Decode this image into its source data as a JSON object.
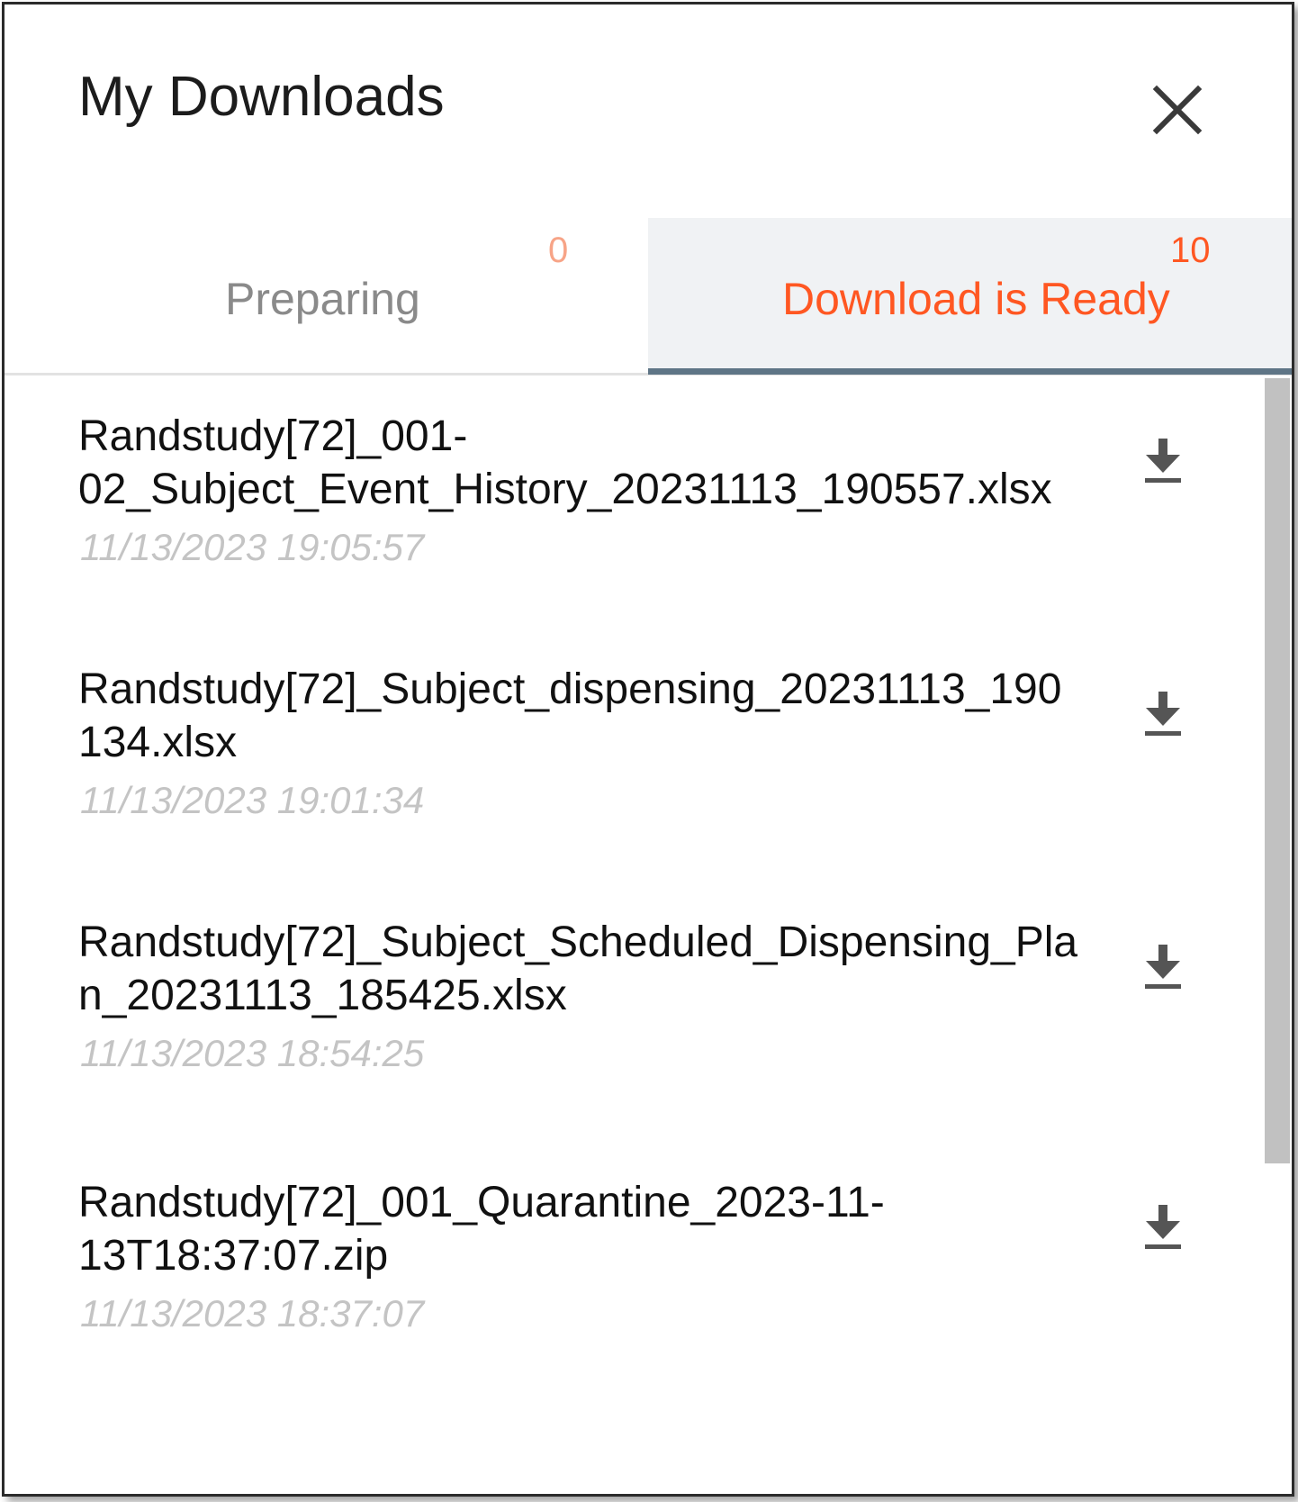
{
  "header": {
    "title": "My Downloads",
    "close_icon": "close-icon"
  },
  "tabs": [
    {
      "label": "Preparing",
      "count": "0",
      "active": false
    },
    {
      "label": "Download is Ready",
      "count": "10",
      "active": true
    }
  ],
  "downloads": [
    {
      "filename": "Randstudy[72]_001-02_Subject_Event_History_20231113_190557.xlsx",
      "filename_display": "Randstudy[72]_001-\n02_Subject_Event_History_20231113_190557.xlsx",
      "date": "11/13/2023 19:05:57",
      "icon": "download-icon"
    },
    {
      "filename": "Randstudy[72]_Subject_dispensing_20231113_190134.xlsx",
      "filename_display": "Randstudy[72]_Subject_dispensing_20231113_190\n134.xlsx",
      "date": "11/13/2023 19:01:34",
      "icon": "download-icon"
    },
    {
      "filename": "Randstudy[72]_Subject_Scheduled_Dispensing_Plan_20231113_185425.xlsx",
      "filename_display": "Randstudy[72]_Subject_Scheduled_Dispensing_Pla\nn_20231113_185425.xlsx",
      "date": "11/13/2023 18:54:25",
      "icon": "download-icon"
    },
    {
      "filename": "Randstudy[72]_001_Quarantine_2023-11-13T18:37:07.zip",
      "filename_display": "Randstudy[72]_001_Quarantine_2023-11-\n13T18:37:07.zip",
      "date": "11/13/2023 18:37:07",
      "icon": "download-icon"
    }
  ],
  "colors": {
    "accent": "#ff5722",
    "accent_muted": "#f7a487",
    "tab_active_bg": "#f0f2f4",
    "tab_indicator": "#5f7586",
    "date_text": "#c4c4c4",
    "scrollbar_thumb": "#c1c1c1"
  }
}
